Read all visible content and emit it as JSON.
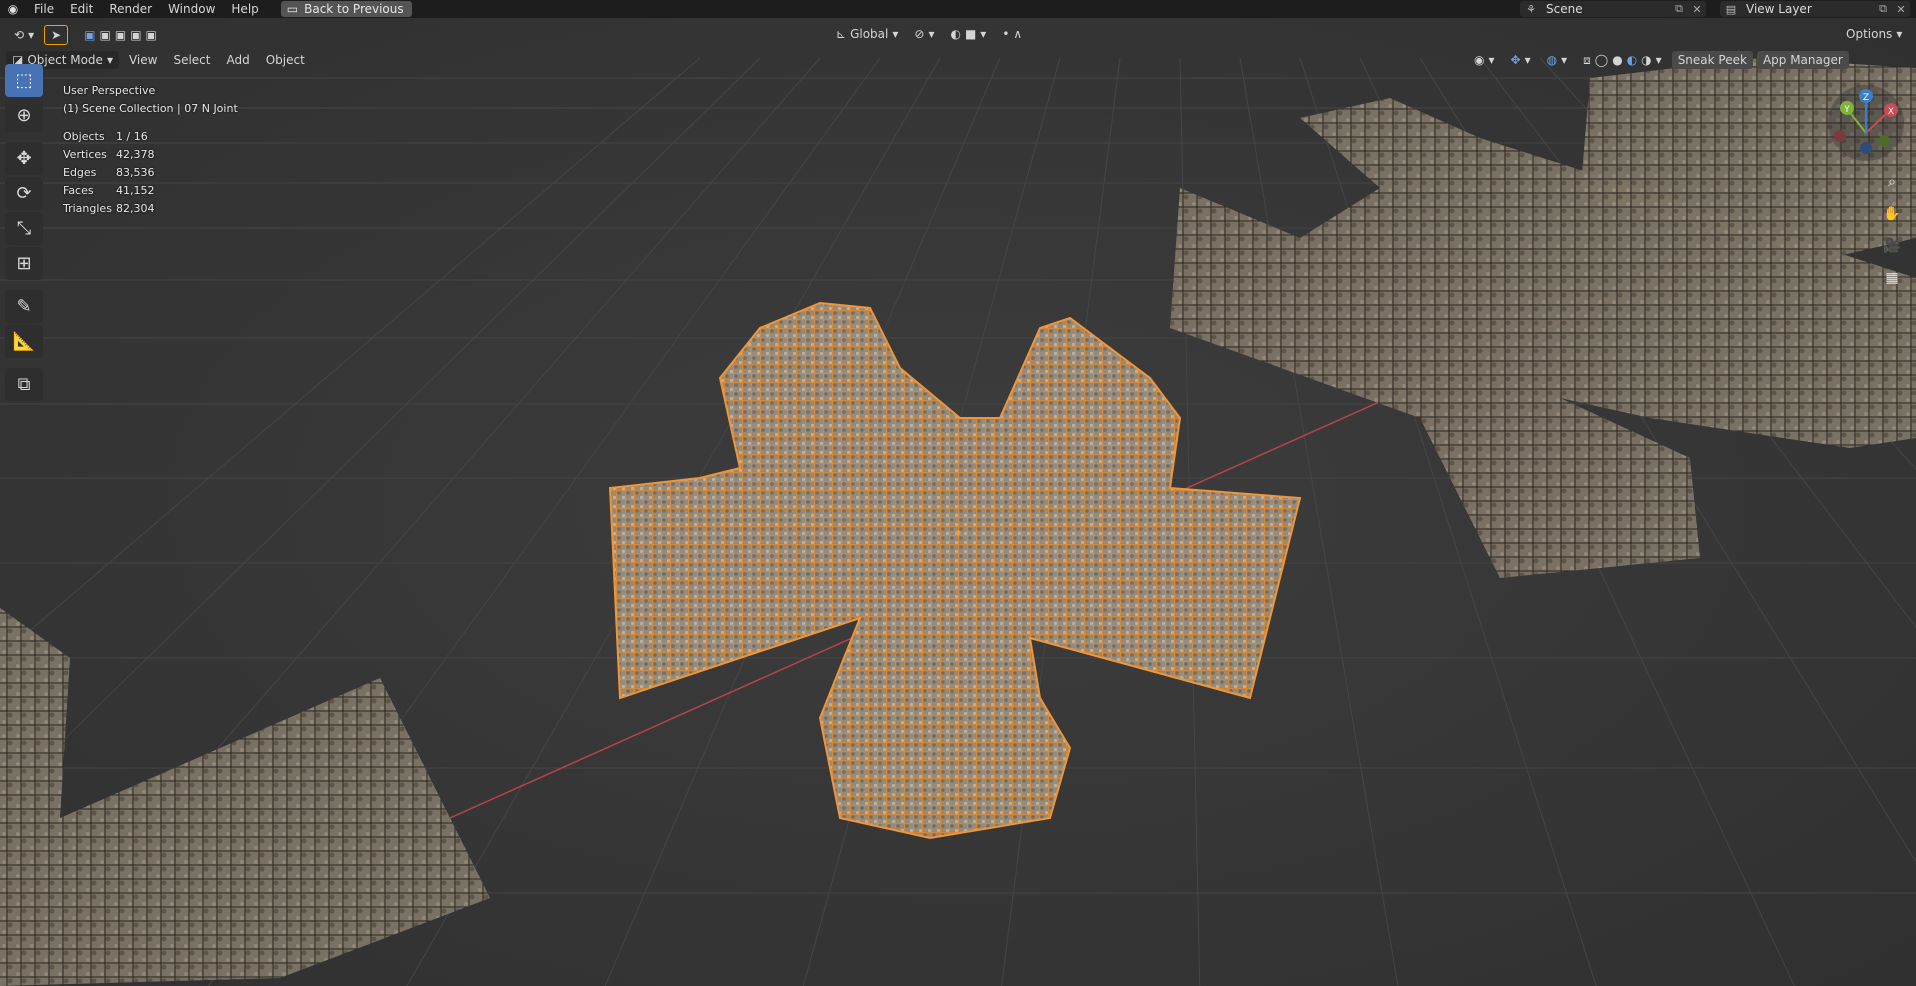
{
  "menubar": {
    "items": [
      "File",
      "Edit",
      "Render",
      "Window",
      "Help"
    ],
    "back_button": "Back to Previous",
    "scene_name": "Scene",
    "view_layer": "View Layer"
  },
  "header": {
    "transform_orientation": "Global",
    "mode": "Object Mode",
    "menus": [
      "View",
      "Select",
      "Add",
      "Object"
    ],
    "sneak_peek": "Sneak Peek",
    "app_manager": "App Manager",
    "options": "Options"
  },
  "overlay": {
    "view_name": "User Perspective",
    "collection": "(1) Scene Collection | 07 N Joint"
  },
  "stats": [
    {
      "label": "Objects",
      "value": "1 / 16"
    },
    {
      "label": "Vertices",
      "value": "42,378"
    },
    {
      "label": "Edges",
      "value": "83,536"
    },
    {
      "label": "Faces",
      "value": "41,152"
    },
    {
      "label": "Triangles",
      "value": "82,304"
    }
  ],
  "gizmo": {
    "x": "X",
    "y": "Y",
    "z": "Z"
  },
  "colors": {
    "accent": "#4772b3",
    "selection": "#f5993a",
    "background": "#3a3a3a"
  }
}
